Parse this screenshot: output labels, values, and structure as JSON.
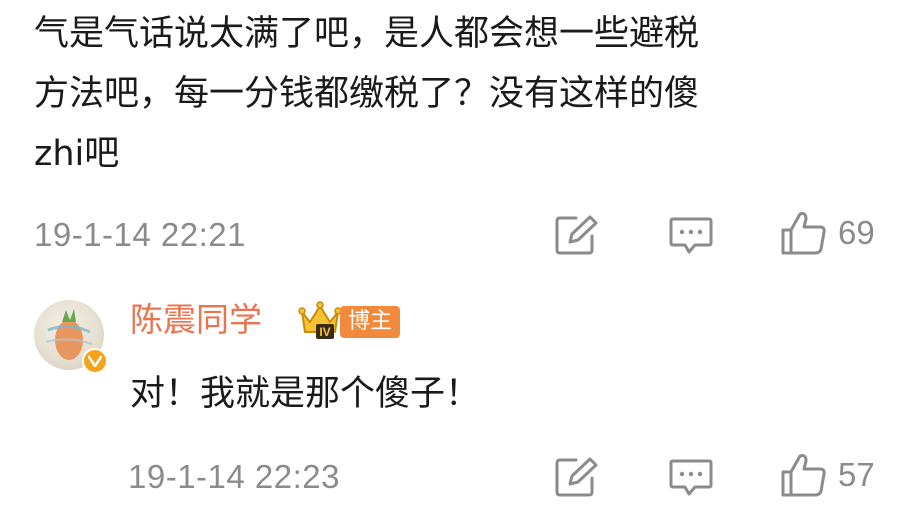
{
  "comment": {
    "text": "气是气话说太满了吧，是人都会想一些避税\n方法吧，每一分钱都缴税了？没有这样的傻\nzhi吧",
    "timestamp": "19-1-14 22:21",
    "like_count": "69"
  },
  "reply": {
    "username": "陈震同学",
    "role_badge": "博主",
    "level_badge": "IV",
    "text": "对！我就是那个傻子！",
    "timestamp": "19-1-14 22:23",
    "like_count": "57"
  },
  "icons": {
    "share": "share-edit-icon",
    "comment": "comment-bubble-icon",
    "like": "thumbs-up-icon",
    "crown": "crown-icon",
    "verified": "verified-badge-icon"
  },
  "colors": {
    "text": "#1a1a1a",
    "meta": "#8b8b8b",
    "username": "#eb7350",
    "badge": "#f28a3d",
    "verified": "#f7a21b"
  }
}
